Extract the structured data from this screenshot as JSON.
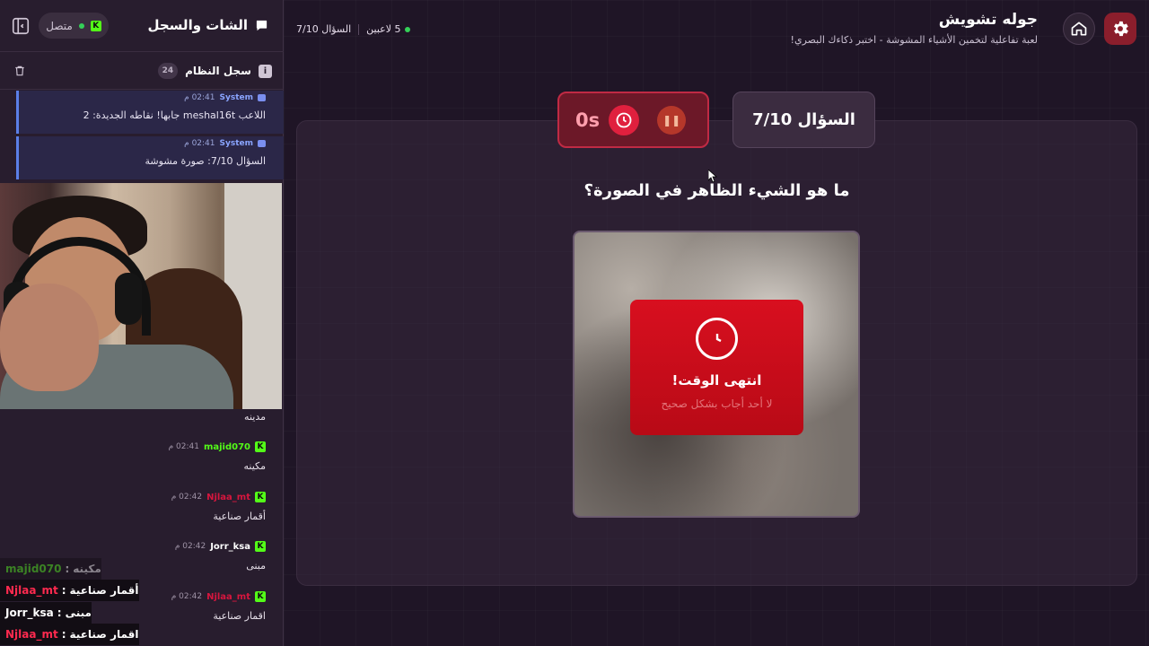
{
  "header": {
    "title": "جوله تشويش",
    "subtitle": "لعبة تفاعلية لتخمين الأشياء المشوشة - اختبر ذكاءك البصري!",
    "players": "5 لاعبين",
    "question_progress": "السؤال 7/10"
  },
  "game": {
    "question_counter": "السؤال 7/10",
    "timer": "0s",
    "question": "ما هو الشيء الظاهر في الصورة؟",
    "timeout_title": "انتهى الوقت!",
    "timeout_subtitle": "لا أحد أجاب بشكل صحيح"
  },
  "sidebar": {
    "title": "الشات والسجل",
    "status": "متصل",
    "system_log_title": "سجل النظام",
    "system_log_count": "24",
    "system_messages": [
      {
        "sender": "System",
        "time": "02:41 م",
        "text": "اللاعب meshal16t جابها! نقاطه الجديدة: 2"
      },
      {
        "sender": "System",
        "time": "02:41 م",
        "text": "السؤال 7/10: صورة مشوشة"
      }
    ],
    "chat_messages": [
      {
        "user": "",
        "time": "",
        "text": "مدينه",
        "color": "#e6dfe9"
      },
      {
        "user": "majid070",
        "time": "02:41 م",
        "text": "مكينه",
        "color": "#53fc18"
      },
      {
        "user": "Njlaa_mt",
        "time": "02:42 م",
        "text": "أقمار صناعية",
        "color": "#d6163e"
      },
      {
        "user": "Jorr_ksa",
        "time": "02:42 م",
        "text": "مبنى",
        "color": "#ffffff"
      },
      {
        "user": "Njlaa_mt",
        "time": "02:42 م",
        "text": "اقمار صناعية",
        "color": "#d6163e"
      }
    ]
  },
  "overlay_chat": [
    {
      "user": "majid070",
      "message": "مكينه",
      "color": "#53fc18"
    },
    {
      "user": "Njlaa_mt",
      "message": "أقمار صناعية",
      "color": "#ff2a4f"
    },
    {
      "user": "Jorr_ksa",
      "message": "مبنى",
      "color": "#ffffff"
    },
    {
      "user": "Njlaa_mt",
      "message": "اقمار صناعية",
      "color": "#ff2a4f"
    }
  ],
  "icons": {
    "settings": "gear-icon",
    "home": "home-icon",
    "pause": "pause-icon",
    "clock": "clock-icon",
    "collapse": "sidebar-collapse-icon",
    "trash": "trash-icon",
    "info": "info-icon",
    "chat": "chat-bubble-icon",
    "kick": "kick-icon"
  },
  "colors": {
    "accent_red": "#d80f1f",
    "kick_green": "#53fc18",
    "online_green": "#34d058"
  }
}
